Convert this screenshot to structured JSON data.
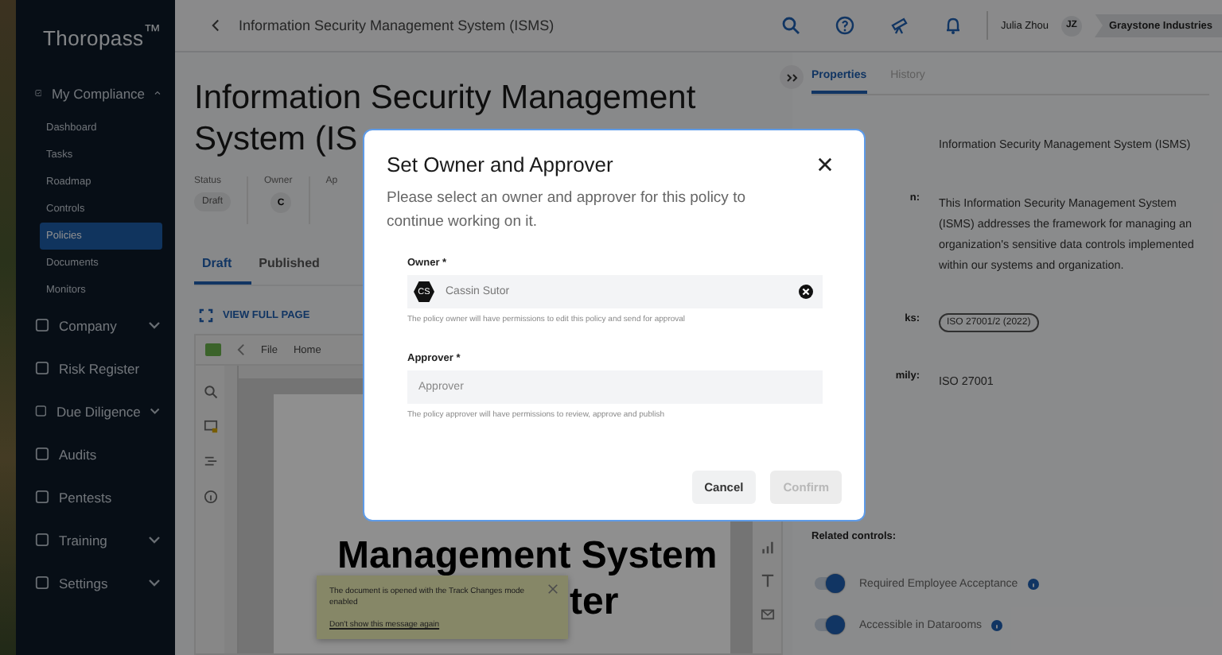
{
  "sidebar": {
    "logo": "Thoropass$^{™}$",
    "items": [
      {
        "label": "My Compliance",
        "kind": "group",
        "expanded": true,
        "children": [
          {
            "label": "Dashboard",
            "selected": false
          },
          {
            "label": "Tasks",
            "selected": false
          },
          {
            "label": "Roadmap",
            "selected": false
          },
          {
            "label": "Controls",
            "selected": false
          },
          {
            "label": "Policies",
            "selected": true
          },
          {
            "label": "Documents",
            "selected": false
          },
          {
            "label": "Monitors",
            "selected": false
          }
        ]
      },
      {
        "label": "Company",
        "kind": "group",
        "expanded": false
      },
      {
        "label": "Risk Register",
        "kind": "link",
        "expanded": false
      },
      {
        "label": "Due Diligence",
        "kind": "group",
        "expanded": false
      },
      {
        "label": "Audits",
        "kind": "link",
        "expanded": false
      },
      {
        "label": "Pentests",
        "kind": "link",
        "expanded": false
      },
      {
        "label": "Training",
        "kind": "group",
        "expanded": false
      },
      {
        "label": "Settings",
        "kind": "group",
        "expanded": false
      }
    ]
  },
  "topbar": {
    "breadcrumb": "Information Security Management System (ISMS)",
    "user_name": "Julia Zhou",
    "user_initials": "JZ",
    "organization": "Graystone Industries"
  },
  "page": {
    "title_lines": [
      "Information Security Management",
      "System (IS"
    ],
    "meta": [
      {
        "label": "Status",
        "value": "Draft",
        "kind": "chip"
      },
      {
        "label": "Owner",
        "value": "C",
        "kind": "avatar"
      },
      {
        "label": "Ap"
      }
    ],
    "tabs": [
      {
        "label": "Draft",
        "selected": true
      },
      {
        "label": "Published",
        "selected": false
      }
    ],
    "view_full_page": "VIEW FULL PAGE",
    "editor": {
      "menu": [
        "File",
        "Home"
      ],
      "document_lines": [
        "Management System",
        "ter"
      ],
      "toast": {
        "message": "The document is opened with the Track Changes mode enabled",
        "link": "Don't show this message again"
      }
    }
  },
  "panel": {
    "tabs": [
      {
        "label": "Properties",
        "selected": true
      },
      {
        "label": "History",
        "selected": false
      }
    ],
    "properties": [
      {
        "value": "Information Security Management System (ISMS)",
        "kind": "text"
      },
      {
        "label": "n:",
        "value": "This Information Security Management System (ISMS) addresses the framework for managing an organization's sensitive data controls implemented within our systems and organization.",
        "kind": "text"
      },
      {
        "label": "ks:",
        "value": "ISO 27001/2 (2022)",
        "kind": "tag"
      },
      {
        "label": "mily:",
        "value": "ISO 27001",
        "kind": "text"
      }
    ],
    "related_label": "Related controls:",
    "controls": [
      {
        "label": "Required Employee Acceptance",
        "on": true
      },
      {
        "label": "Accessible in Datarooms",
        "on": true
      }
    ]
  },
  "modal": {
    "title": "Set Owner and Approver",
    "description": "Please select an owner and approver for this policy to continue working on it.",
    "fields": [
      {
        "label": "Owner *",
        "value": "Cassin Sutor",
        "initials": "CS",
        "hint": "The policy owner will have permissions to edit this policy and send for approval"
      },
      {
        "label": "Approver *",
        "placeholder": "Approver",
        "hint": "The policy approver will have permissions to review, approve and publish"
      }
    ],
    "buttons": [
      {
        "label": "Cancel",
        "disabled": false
      },
      {
        "label": "Confirm",
        "disabled": true
      }
    ]
  }
}
